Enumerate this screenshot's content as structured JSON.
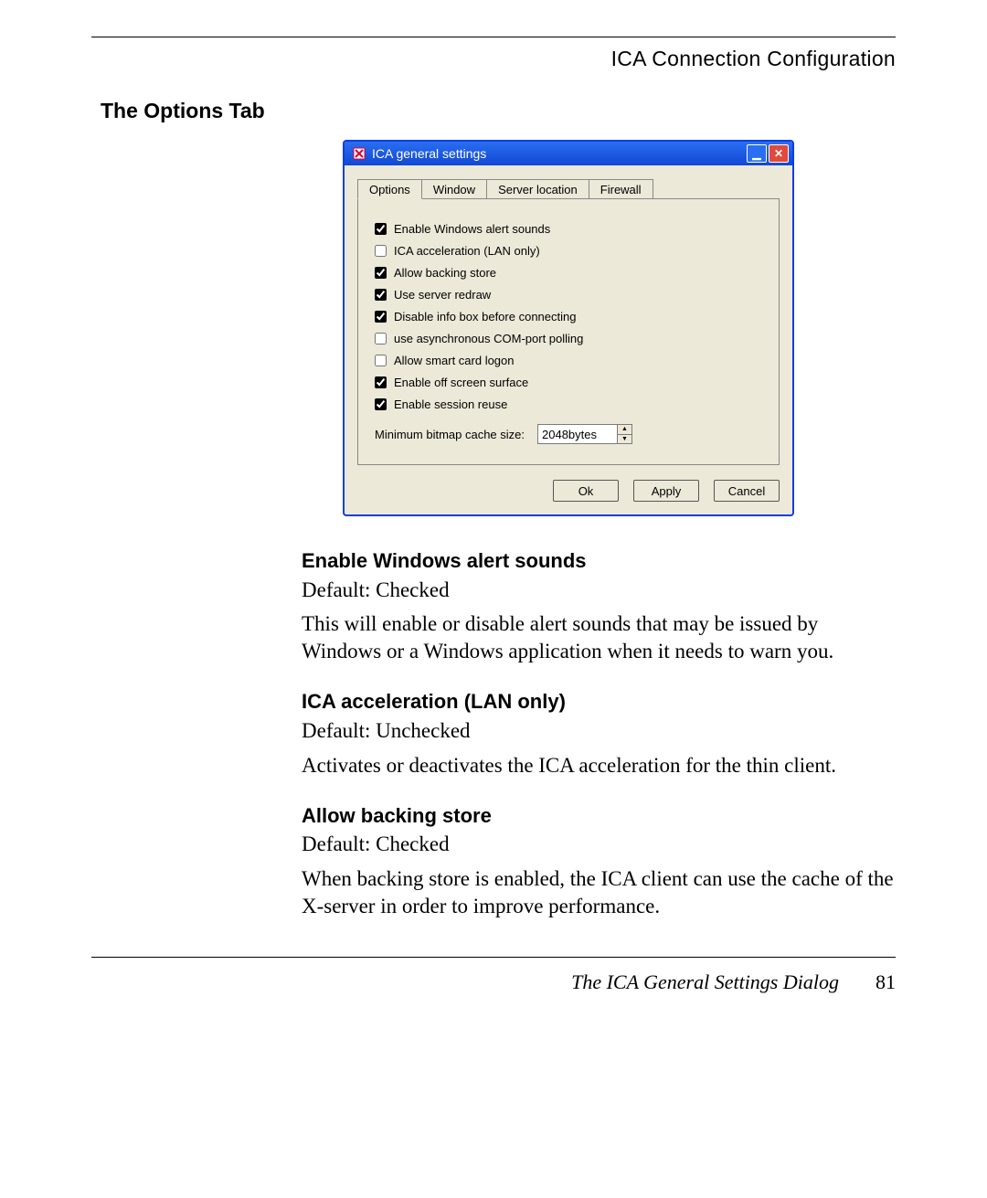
{
  "header": {
    "running": "ICA Connection Configuration"
  },
  "section": {
    "title": "The Options Tab"
  },
  "dialog": {
    "title": "ICA general settings",
    "tabs": [
      "Options",
      "Window",
      "Server location",
      "Firewall"
    ],
    "options": [
      {
        "label": "Enable Windows alert sounds",
        "checked": true
      },
      {
        "label": "ICA acceleration (LAN only)",
        "checked": false
      },
      {
        "label": "Allow backing store",
        "checked": true
      },
      {
        "label": "Use server redraw",
        "checked": true
      },
      {
        "label": "Disable info box before connecting",
        "checked": true
      },
      {
        "label": "use asynchronous COM-port polling",
        "checked": false
      },
      {
        "label": "Allow smart card logon",
        "checked": false
      },
      {
        "label": "Enable off screen surface",
        "checked": true
      },
      {
        "label": "Enable session reuse",
        "checked": true
      }
    ],
    "bitmap": {
      "label": "Minimum bitmap cache size:",
      "value": "2048bytes"
    },
    "buttons": {
      "ok": "Ok",
      "apply": "Apply",
      "cancel": "Cancel"
    }
  },
  "doc": {
    "items": [
      {
        "title": "Enable Windows alert sounds",
        "default": "Default: Checked",
        "desc": "This will enable or disable alert sounds that may be issued by Windows or a Windows application when it needs to warn you."
      },
      {
        "title": "ICA acceleration (LAN only)",
        "default": "Default: Unchecked",
        "desc": "Activates or deactivates the ICA acceleration for the thin client."
      },
      {
        "title": "Allow backing store",
        "default": "Default: Checked",
        "desc": "When backing store is enabled, the ICA client can use the cache of the X-server in order to improve performance."
      }
    ]
  },
  "footer": {
    "text": "The ICA General Settings Dialog",
    "page": "81"
  }
}
